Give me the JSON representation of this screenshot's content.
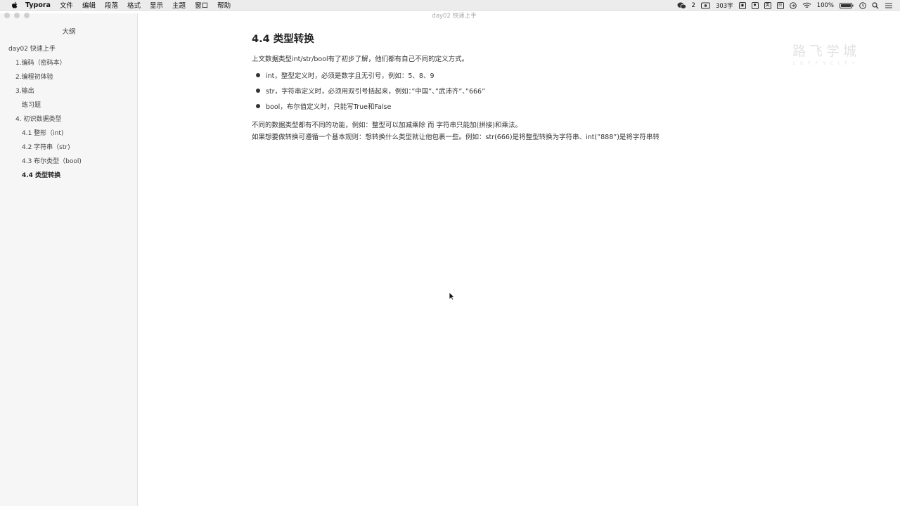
{
  "menubar": {
    "app_name": "Typora",
    "items": [
      "文件",
      "编辑",
      "段落",
      "格式",
      "显示",
      "主题",
      "窗口",
      "帮助"
    ],
    "wechat_count": "2",
    "word_count": "303字",
    "input_method": "英",
    "battery": "100%"
  },
  "window": {
    "title": "day02 快速上手"
  },
  "sidebar": {
    "title": "大纲",
    "items": [
      {
        "label": "day02 快速上手"
      },
      {
        "label": "1.编码（密码本）"
      },
      {
        "label": "2.编程初体验"
      },
      {
        "label": "3.输出"
      },
      {
        "label": "练习题"
      },
      {
        "label": "4. 初识数据类型"
      },
      {
        "label": "4.1 整形（int)"
      },
      {
        "label": "4.2 字符串（str)"
      },
      {
        "label": "4.3 布尔类型（bool)"
      },
      {
        "label": "4.4 类型转换"
      }
    ]
  },
  "doc": {
    "heading": "4.4 类型转换",
    "intro": "上文数据类型int/str/bool有了初步了解，他们都有自己不同的定义方式。",
    "bullets": [
      "int，整型定义时，必须是数字且无引号，例如：5、8、9",
      "str，字符串定义时，必须用双引号括起来，例如：”中国”、”武沛齐”、”666”",
      "bool，布尔值定义时，只能写True和False"
    ],
    "para1": "不同的数据类型都有不同的功能，例如：整型可以加减乘除 而 字符串只能加(拼接)和乘法。",
    "para2": "如果想要做转换可遵循一个基本规则：想转换什么类型就让他包裹一些。例如：str(666)是将整型转换为字符串、int(”888”)是将字符串转"
  },
  "watermark": {
    "main": "路飞学城",
    "sub": "LUFFYCITY"
  }
}
